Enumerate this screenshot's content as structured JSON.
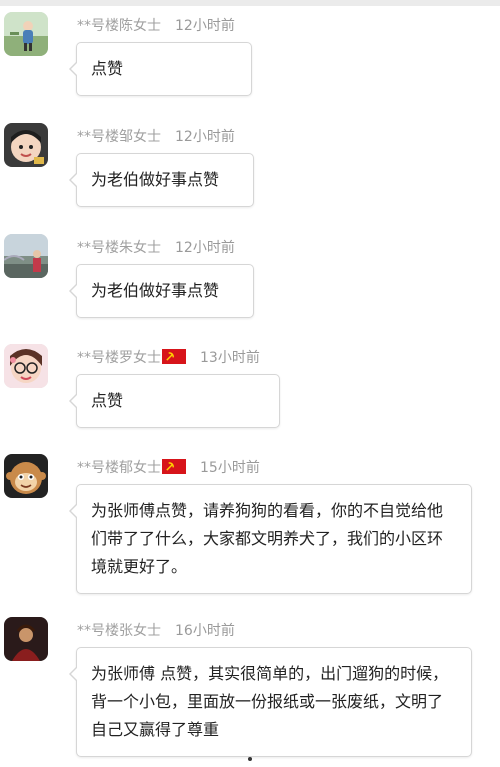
{
  "comments": [
    {
      "user": "**号楼陈女士",
      "time": "12小时前",
      "text": "点赞",
      "flag": false,
      "avatar": "avatar-photo-child-outdoor"
    },
    {
      "user": "**号楼邹女士",
      "time": "12小时前",
      "text": "为老伯做好事点赞",
      "flag": false,
      "avatar": "avatar-photo-child-closeup"
    },
    {
      "user": "**号楼朱女士",
      "time": "12小时前",
      "text": "为老伯做好事点赞",
      "flag": false,
      "avatar": "avatar-photo-woman-scenery"
    },
    {
      "user": "**号楼罗女士",
      "time": "13小时前",
      "text": "点赞",
      "flag": true,
      "avatar": "avatar-photo-girl-glasses"
    },
    {
      "user": "**号楼郁女士",
      "time": "15小时前",
      "text": "为张师傅点赞，请养狗狗的看看，你的不自觉给他们带了了什么，大家都文明养犬了，我们的小区环境就更好了。",
      "flag": true,
      "avatar": "avatar-cartoon-monkey"
    },
    {
      "user": "**号楼张女士",
      "time": "16小时前",
      "text": "为张师傅 点赞，其实很简单的，出门遛狗的时候，背一个小包，里面放一份报纸或一张废纸，文明了自己又赢得了尊重",
      "flag": false,
      "avatar": "avatar-photo-dark-portrait"
    }
  ],
  "colors": {
    "meta_text": "#9a9a9a",
    "bubble_border": "#d6d6d6",
    "flag_red": "#d7141a",
    "body_text": "#222222"
  }
}
